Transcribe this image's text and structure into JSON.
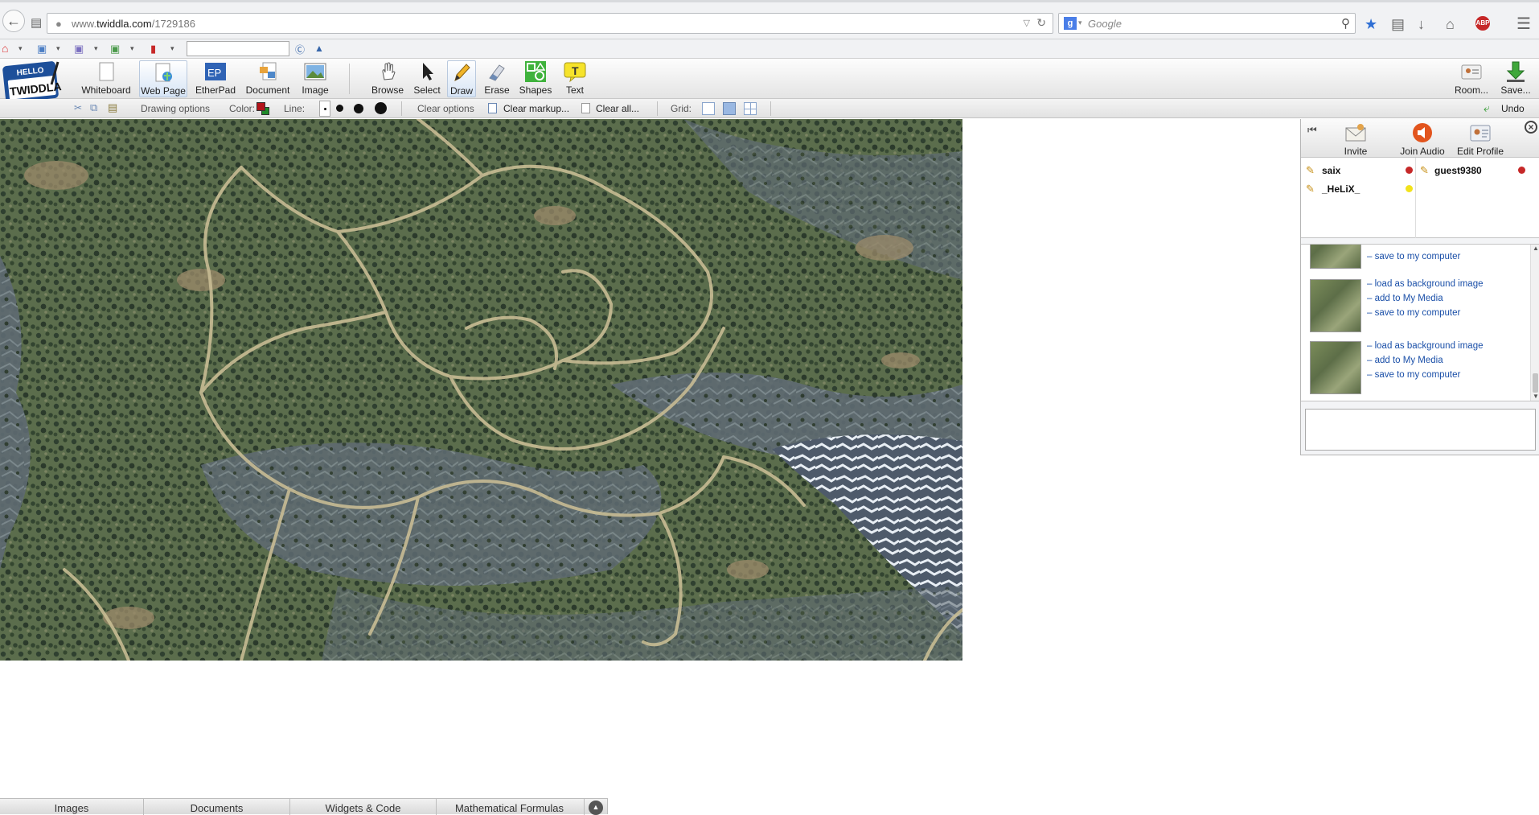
{
  "browser": {
    "url_prefix": "www.",
    "url_domain": "twiddla.com",
    "url_path": "/1729186",
    "search_placeholder": "Google"
  },
  "toolbar": {
    "logo_top": "HELLO",
    "logo_bottom": "TWIDDLA",
    "tools": [
      {
        "label": "Whiteboard"
      },
      {
        "label": "Web Page"
      },
      {
        "label": "EtherPad"
      },
      {
        "label": "Document"
      },
      {
        "label": "Image"
      },
      {
        "label": "Browse"
      },
      {
        "label": "Select"
      },
      {
        "label": "Draw"
      },
      {
        "label": "Erase"
      },
      {
        "label": "Shapes"
      },
      {
        "label": "Text"
      }
    ],
    "etherpad_icon_text": "EP",
    "text_icon_text": "T",
    "room_label": "Room...",
    "save_label": "Save..."
  },
  "options": {
    "drawing_options": "Drawing options",
    "color_label": "Color:",
    "line_label": "Line:",
    "clear_options": "Clear options",
    "clear_markup": "Clear markup...",
    "clear_all": "Clear all...",
    "grid_label": "Grid:",
    "undo_label": "Undo",
    "color_primary": "#b3151b",
    "color_secondary": "#1f8a2a"
  },
  "side_panel": {
    "invite": "Invite",
    "join_audio": "Join Audio",
    "edit_profile": "Edit Profile",
    "users": [
      {
        "name": "saix",
        "status_color": "#c62828"
      },
      {
        "name": "_HeLiX_",
        "status_color": "#f2e21b"
      },
      {
        "name": "guest9380",
        "status_color": "#c62828"
      }
    ],
    "media": [
      {
        "links": [
          "save to my computer"
        ]
      },
      {
        "links": [
          "load as background image",
          "add to My Media",
          "save to my computer"
        ]
      },
      {
        "links": [
          "load as background image",
          "add to My Media",
          "save to my computer"
        ]
      }
    ]
  },
  "bottom_tabs": [
    "Images",
    "Documents",
    "Widgets & Code",
    "Mathematical Formulas"
  ]
}
